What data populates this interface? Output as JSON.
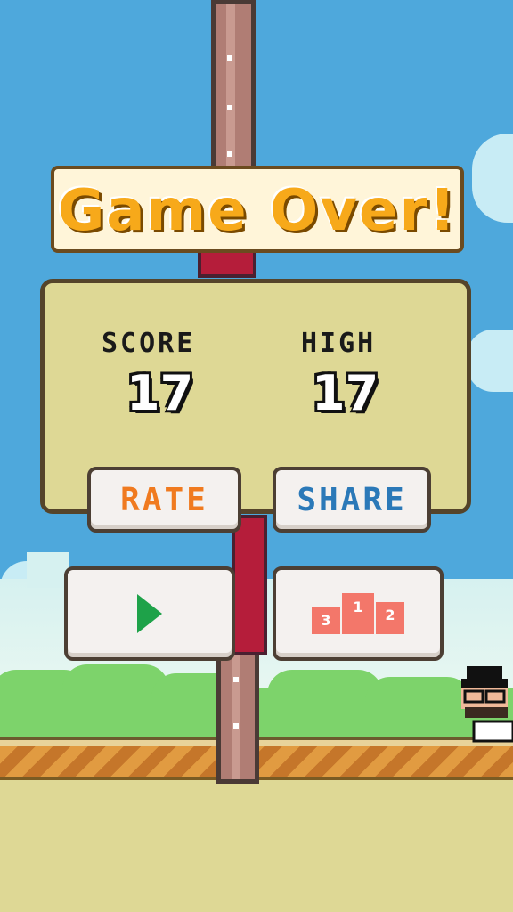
{
  "game_over": {
    "title": "Game Over!"
  },
  "scoreboard": {
    "score_label": "SCORE",
    "score_value": "17",
    "high_label": "HIGH",
    "high_value": "17"
  },
  "buttons": {
    "rate_label": "RATE",
    "share_label": "SHARE",
    "play_icon": "play-icon",
    "leaderboard_icon": "leaderboard-podium-icon",
    "podium_labels": [
      "3",
      "1",
      "2"
    ]
  },
  "colors": {
    "sky": "#4ea8dc",
    "title": "#f7a91a",
    "rate": "#f07a1f",
    "share": "#2b79b8",
    "play": "#1ea249",
    "podium": "#f3776a",
    "panel": "#ded895"
  }
}
